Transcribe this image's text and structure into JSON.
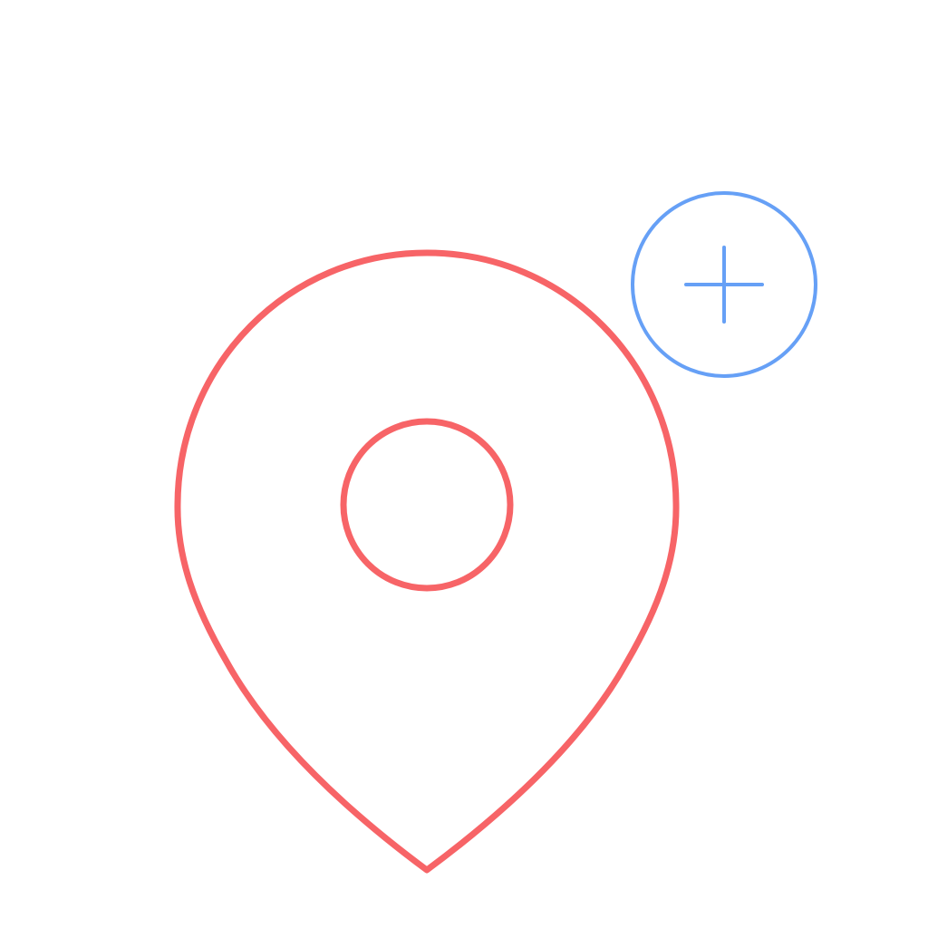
{
  "icon": {
    "pin_name": "map-pin-icon",
    "add_name": "plus-circle-icon",
    "colors": {
      "pin_stroke": "#F76467",
      "add_stroke": "#66A0F6",
      "background": "#FFFFFF"
    }
  }
}
